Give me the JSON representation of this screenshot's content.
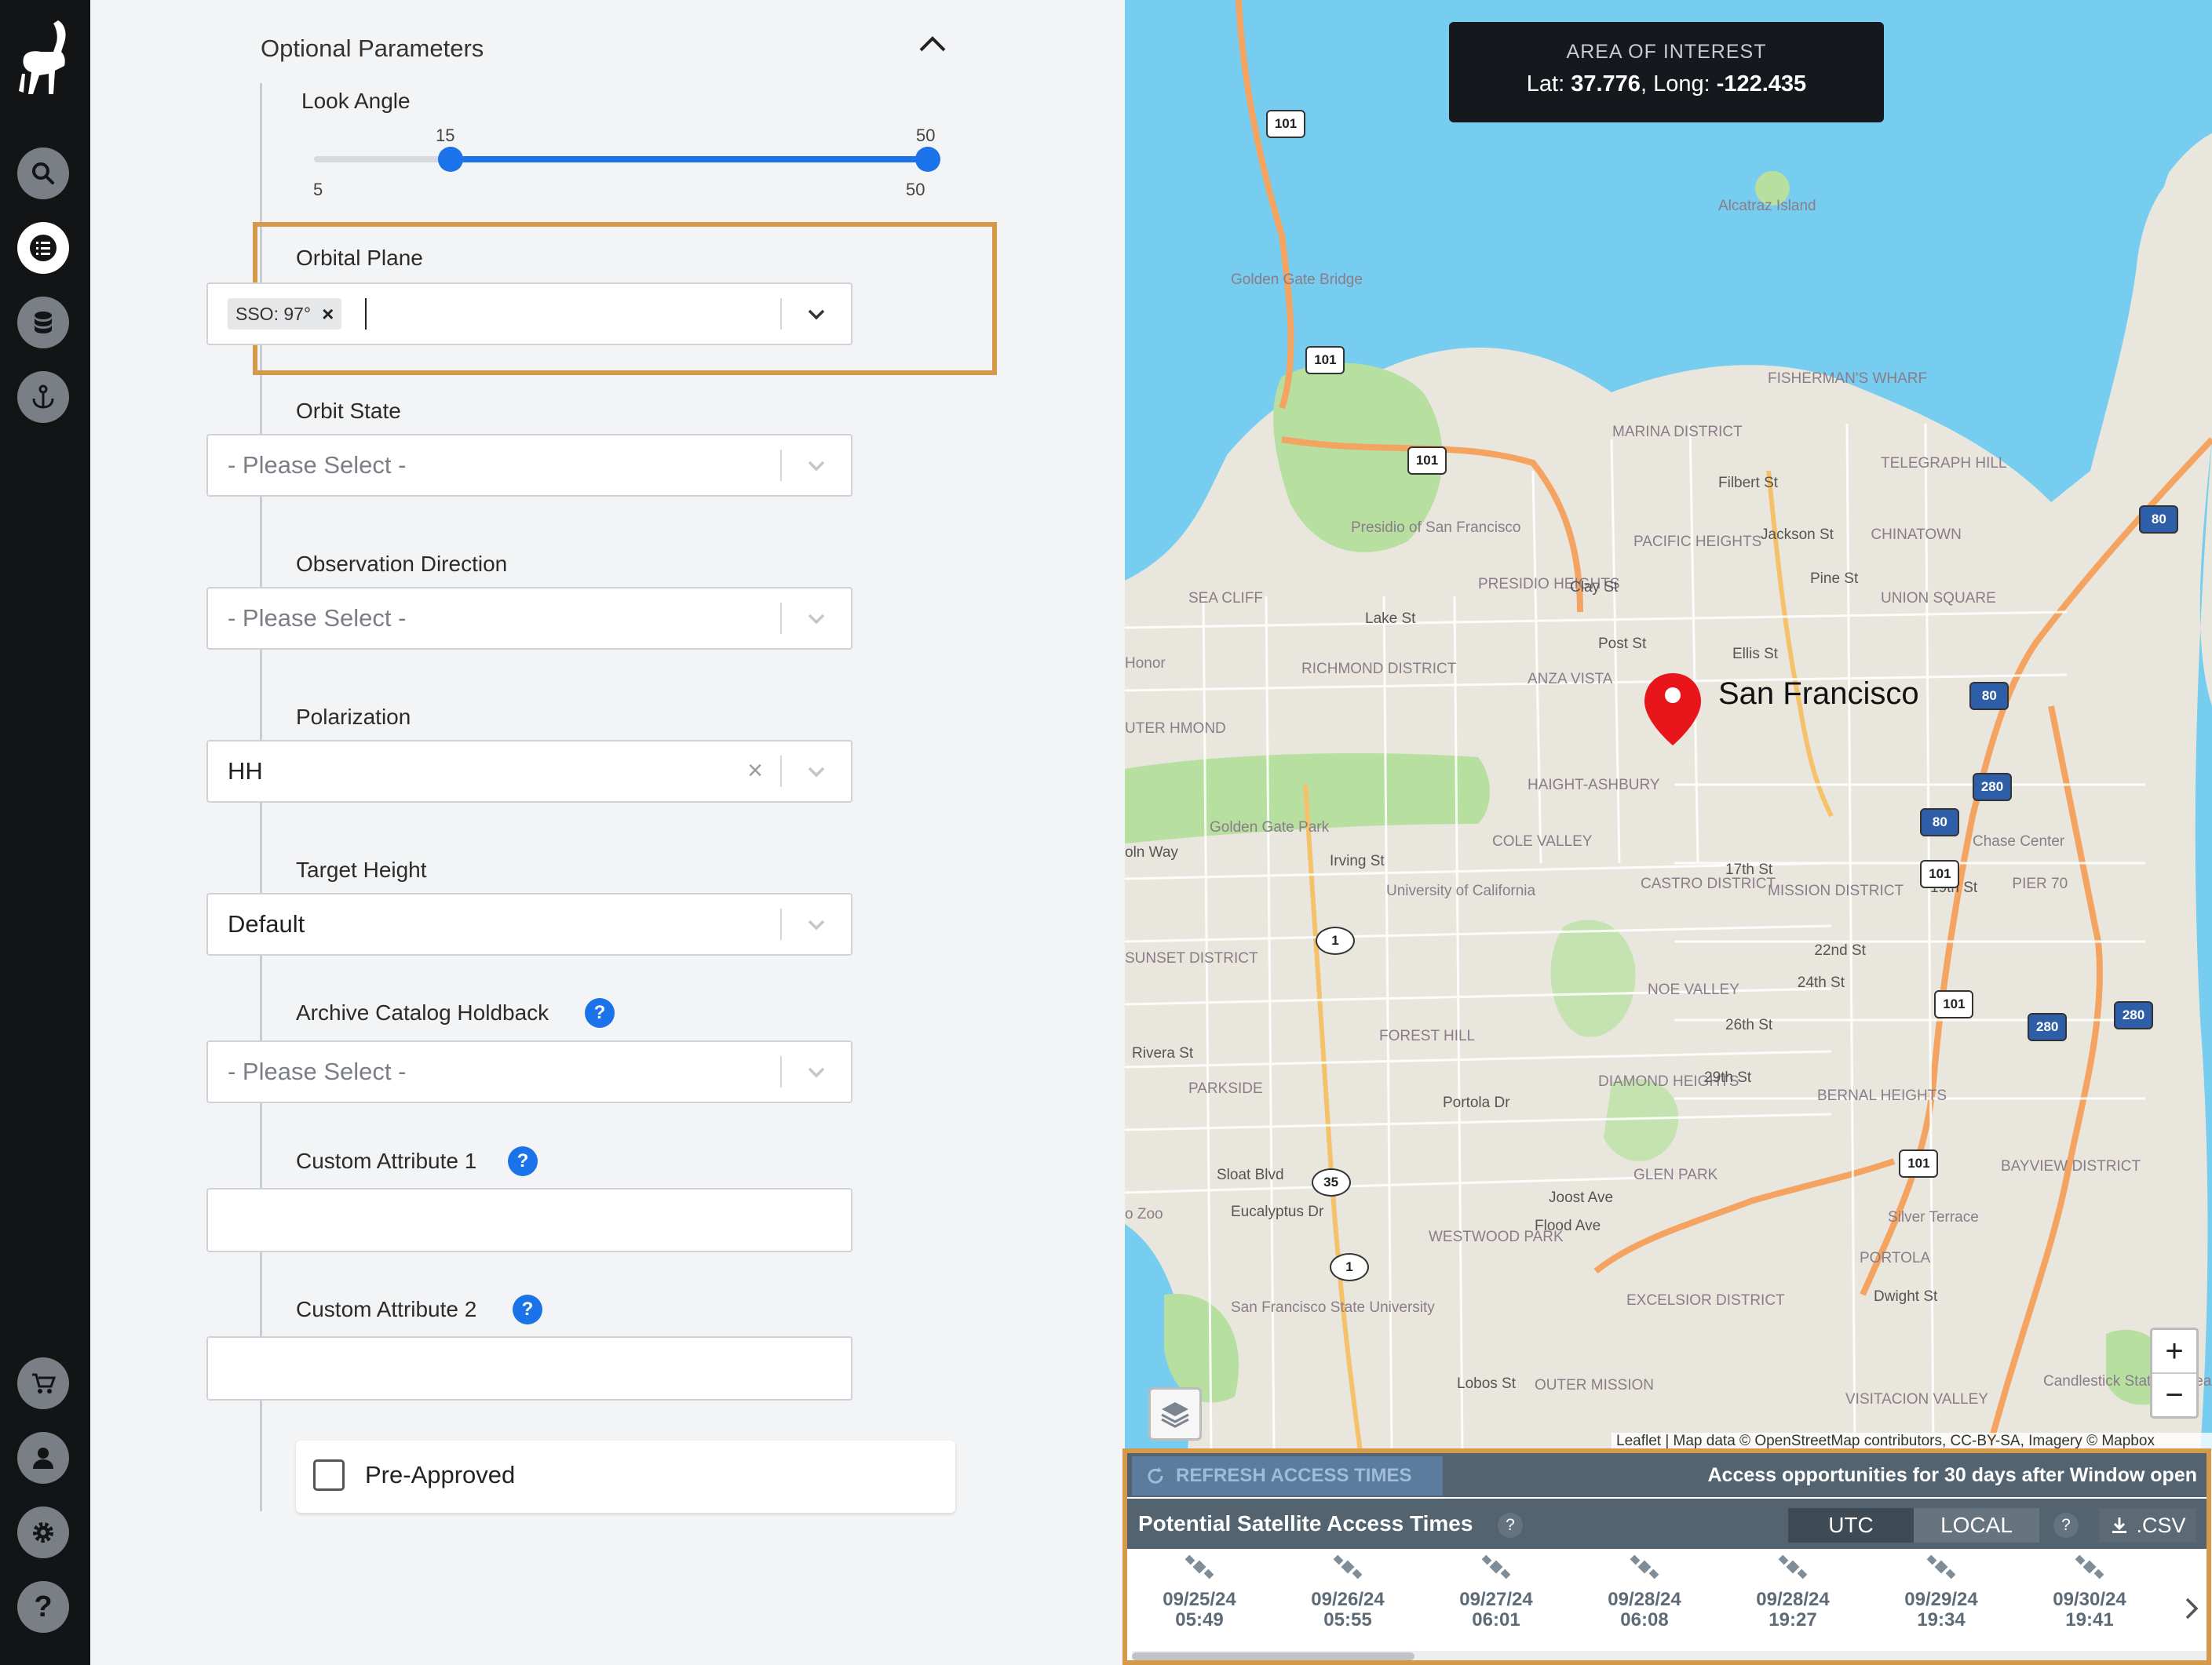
{
  "form": {
    "optional_params_title": "Optional Parameters",
    "look_angle": {
      "label": "Look Angle",
      "value_low": "15",
      "value_high": "50",
      "min_label": "5",
      "max_label": "50",
      "range_min": 5,
      "range_max": 50,
      "low": 15,
      "high": 50
    },
    "orbital_plane": {
      "label": "Orbital Plane",
      "tag": "SSO: 97°",
      "tag_remove": "×"
    },
    "orbit_state": {
      "label": "Orbit State",
      "placeholder": "- Please Select -"
    },
    "observation_direction": {
      "label": "Observation Direction",
      "placeholder": "- Please Select -"
    },
    "polarization": {
      "label": "Polarization",
      "value": "HH",
      "clear": "×"
    },
    "target_height": {
      "label": "Target Height",
      "value": "Default"
    },
    "archive_holdback": {
      "label": "Archive Catalog Holdback",
      "placeholder": "- Please Select -",
      "help": "?"
    },
    "custom_attribute_1": {
      "label": "Custom Attribute 1",
      "help": "?",
      "value": ""
    },
    "custom_attribute_2": {
      "label": "Custom Attribute 2",
      "help": "?",
      "value": ""
    },
    "pre_approved": {
      "label": "Pre-Approved",
      "checked": false
    }
  },
  "nav": {
    "items": [
      "search-icon",
      "tasking-list-icon",
      "database-icon",
      "anchor-icon",
      "cart-icon",
      "user-icon",
      "gear-icon",
      "help-icon"
    ],
    "help_label": "?"
  },
  "map": {
    "aoi_title": "AREA OF INTEREST",
    "lat_label": "Lat:",
    "lat_value": "37.776",
    "long_label": "Long:",
    "long_value": "-122.435",
    "city_label": "San Francisco",
    "zoom_in": "+",
    "zoom_out": "−",
    "attribution": "Leaflet | Map data © OpenStreetMap contributors, CC-BY-SA, Imagery © Mapbox",
    "labels": [
      "Alcatraz Island",
      "Golden Gate Bridge",
      "FISHERMAN'S WHARF",
      "MARINA DISTRICT",
      "TELEGRAPH HILL",
      "Presidio of San Francisco",
      "PACIFIC HEIGHTS",
      "CHINATOWN",
      "UNION SQUARE",
      "SEA CLIFF",
      "PRESIDIO HEIGHTS",
      "RICHMOND DISTRICT",
      "ANZA VISTA",
      "Golden Gate Park",
      "HAIGHT-ASHBURY",
      "COLE VALLEY",
      "University of California",
      "CASTRO DISTRICT",
      "MISSION DISTRICT",
      "Chase Center",
      "PIER 70",
      "SUNSET DISTRICT",
      "NOE VALLEY",
      "FOREST HILL",
      "PARKSIDE",
      "DIAMOND HEIGHTS",
      "BERNAL HEIGHTS",
      "GLEN PARK",
      "BAYVIEW DISTRICT",
      "Silver Terrace",
      "WESTWOOD PARK",
      "PORTOLA",
      "San Francisco State University",
      "EXCELSIOR DISTRICT",
      "OUTER MISSION",
      "VISITACION VALLEY",
      "Candlestick State Recrea",
      "Lake St",
      "Post St",
      "Ellis St",
      "Pine St",
      "Jackson St",
      "Filbert St",
      "Clay St",
      "Irving St",
      "17th St",
      "19th St",
      "22nd St",
      "24th St",
      "26th St",
      "29th St",
      "Rivera St",
      "Sloat Blvd",
      "Eucalyptus Dr",
      "Joost Ave",
      "Flood Ave",
      "Lobos St",
      "Dwight St",
      "Portola Dr",
      "Honor",
      "UTER HMOND",
      "oln Way",
      "o Zoo"
    ],
    "shields": [
      "101",
      "101",
      "101",
      "80",
      "80",
      "80",
      "280",
      "280",
      "280",
      "101",
      "101",
      "101",
      "1",
      "1",
      "35"
    ]
  },
  "access": {
    "refresh_label": "REFRESH ACCESS TIMES",
    "window_note": "Access opportunities for 30 days after Window open",
    "title": "Potential Satellite Access Times",
    "help": "?",
    "utc_label": "UTC",
    "local_label": "LOCAL",
    "tz_help": "?",
    "csv_label": ".CSV",
    "passes": [
      {
        "date": "09/25/24",
        "time": "05:49"
      },
      {
        "date": "09/26/24",
        "time": "05:55"
      },
      {
        "date": "09/27/24",
        "time": "06:01"
      },
      {
        "date": "09/28/24",
        "time": "06:08"
      },
      {
        "date": "09/28/24",
        "time": "19:27"
      },
      {
        "date": "09/29/24",
        "time": "19:34"
      },
      {
        "date": "09/30/24",
        "time": "19:41"
      }
    ]
  },
  "colors": {
    "accent": "#1a73e8",
    "highlight_border": "#d49a4a",
    "rail": "#121416",
    "water": "#76cdf0",
    "access_header": "#53636f"
  }
}
